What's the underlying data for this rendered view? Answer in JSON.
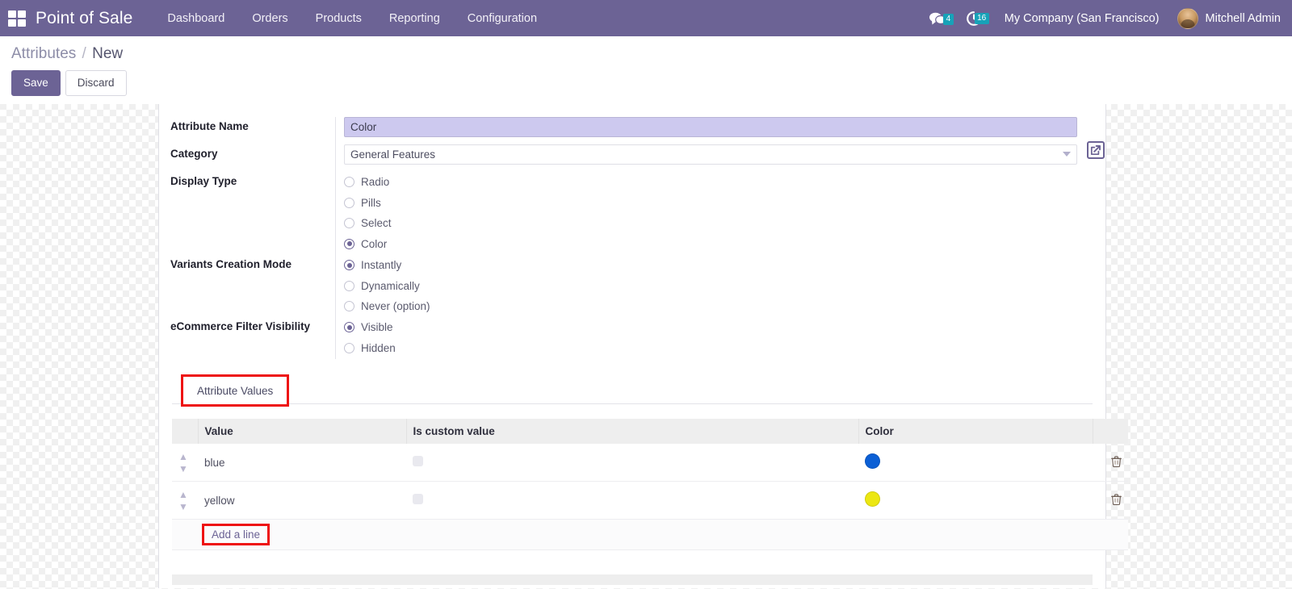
{
  "navbar": {
    "apps_icon": "apps-grid-icon",
    "brand": "Point of Sale",
    "menu": [
      {
        "label": "Dashboard"
      },
      {
        "label": "Orders"
      },
      {
        "label": "Products"
      },
      {
        "label": "Reporting"
      },
      {
        "label": "Configuration"
      }
    ],
    "messages_icon": "chat-bubble-icon",
    "messages_count": "4",
    "activities_icon": "clock-activity-icon",
    "activities_count": "16",
    "company": "My Company (San Francisco)",
    "avatar_icon": "user-avatar",
    "user_name": "Mitchell Admin",
    "background_color": "#6c6395"
  },
  "control_panel": {
    "breadcrumb_root": "Attributes",
    "breadcrumb_sep": "/",
    "breadcrumb_current": "New",
    "save_label": "Save",
    "discard_label": "Discard"
  },
  "form": {
    "attribute_name": {
      "label": "Attribute Name",
      "value": "Color",
      "placeholder": ""
    },
    "category": {
      "label": "Category",
      "value": "General Features",
      "placeholder": "",
      "dropdown_icon": "chevron-down-icon",
      "external_link_icon": "internal-link-icon"
    },
    "display_type": {
      "label": "Display Type",
      "options": [
        {
          "label": "Radio",
          "selected": false
        },
        {
          "label": "Pills",
          "selected": false
        },
        {
          "label": "Select",
          "selected": false
        },
        {
          "label": "Color",
          "selected": true
        }
      ]
    },
    "variants_creation_mode": {
      "label": "Variants Creation Mode",
      "options": [
        {
          "label": "Instantly",
          "selected": true
        },
        {
          "label": "Dynamically",
          "selected": false
        },
        {
          "label": "Never (option)",
          "selected": false
        }
      ]
    },
    "ecommerce_filter_visibility": {
      "label": "eCommerce Filter Visibility",
      "options": [
        {
          "label": "Visible",
          "selected": true
        },
        {
          "label": "Hidden",
          "selected": false
        }
      ]
    }
  },
  "notebook": {
    "tabs": [
      {
        "label": "Attribute Values",
        "active": true,
        "highlighted": true
      }
    ]
  },
  "values_table": {
    "columns": [
      "",
      "Value",
      "Is custom value",
      "Color",
      ""
    ],
    "rows": [
      {
        "handle_icon": "drag-handle-icon",
        "value": "blue",
        "is_custom_value": false,
        "color": "#0b5fd5",
        "delete_icon": "trash-icon"
      },
      {
        "handle_icon": "drag-handle-icon",
        "value": "yellow",
        "is_custom_value": false,
        "color": "#ece712",
        "delete_icon": "trash-icon"
      }
    ],
    "add_line_label": "Add a line",
    "add_line_highlighted": true
  },
  "highlight_color": "#ee1111"
}
